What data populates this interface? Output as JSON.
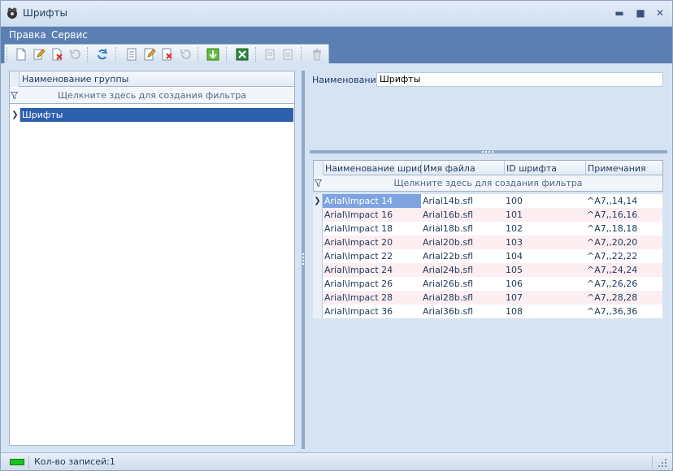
{
  "window": {
    "title": "Шрифты",
    "minimize": "▬",
    "maximize": "■",
    "close": "✕"
  },
  "menu": {
    "items": [
      "Правка",
      "Сервис"
    ]
  },
  "toolbar": {
    "buttons": [
      {
        "name": "new-icon"
      },
      {
        "name": "edit-icon"
      },
      {
        "name": "delete-icon"
      },
      {
        "name": "undo-icon"
      },
      {
        "name": "refresh-icon"
      },
      {
        "name": "new-detail-icon"
      },
      {
        "name": "edit-detail-icon"
      },
      {
        "name": "delete-detail-icon"
      },
      {
        "name": "undo-detail-icon"
      },
      {
        "name": "download-icon"
      },
      {
        "name": "excel-export-icon"
      },
      {
        "name": "move-up-icon"
      },
      {
        "name": "move-down-icon"
      },
      {
        "name": "trash-icon"
      }
    ]
  },
  "groups": {
    "column_header": "Наименование группы",
    "filter_hint": "Щелкните здесь для создания фильтра",
    "rows": [
      "Шрифты"
    ]
  },
  "detail": {
    "name_label": "Наименование",
    "name_value": "Шрифты"
  },
  "fonts": {
    "columns": [
      "Наименование шрифта",
      "Имя файла",
      "ID шрифта",
      "Примечания"
    ],
    "filter_hint": "Щелкните здесь для создания фильтра",
    "rows": [
      [
        "Arial\\Impact 14",
        "Arial14b.sfl",
        "100",
        "^A7,,14,14"
      ],
      [
        "Arial\\Impact 16",
        "Arial16b.sfl",
        "101",
        "^A7,,16,16"
      ],
      [
        "Arial\\Impact 18",
        "Arial18b.sfl",
        "102",
        "^A7,,18,18"
      ],
      [
        "Arial\\Impact 20",
        "Arial20b.sfl",
        "103",
        "^A7,,20,20"
      ],
      [
        "Arial\\Impact 22",
        "Arial22b.sfl",
        "104",
        "^A7,,22,22"
      ],
      [
        "Arial\\Impact 24",
        "Arial24b.sfl",
        "105",
        "^A7,,24,24"
      ],
      [
        "Arial\\Impact 26",
        "Arial26b.sfl",
        "106",
        "^A7,,26,26"
      ],
      [
        "Arial\\Impact 28",
        "Arial28b.sfl",
        "107",
        "^A7,,28,28"
      ],
      [
        "Arial\\Impact 36",
        "Arial36b.sfl",
        "108",
        "^A7,,36,36"
      ]
    ]
  },
  "status": {
    "records": "Кол-во записей:1"
  },
  "colors": {
    "menu_bg": "#5b7fb3",
    "selection": "#2d5fae",
    "alt_row": "#fdeef2"
  }
}
